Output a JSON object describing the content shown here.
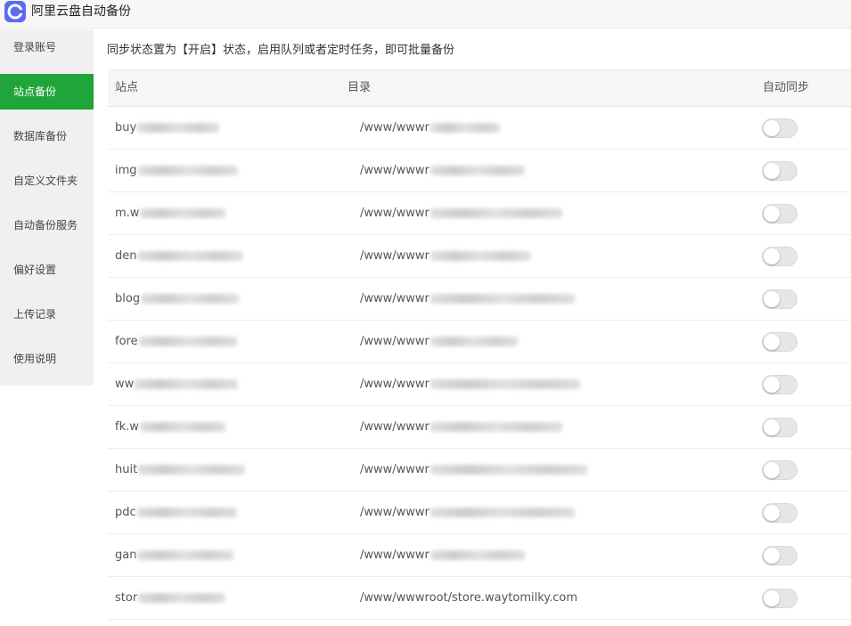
{
  "app": {
    "title": "阿里云盘自动备份",
    "logo_icon": "aliyun-drive-logo-icon",
    "accent_color": "#20a53a"
  },
  "sidebar": {
    "active_index": 1,
    "items": [
      {
        "label": "登录账号"
      },
      {
        "label": "站点备份"
      },
      {
        "label": "数据库备份"
      },
      {
        "label": "自定义文件夹"
      },
      {
        "label": "自动备份服务"
      },
      {
        "label": "偏好设置"
      },
      {
        "label": "上传记录"
      },
      {
        "label": "使用说明"
      }
    ]
  },
  "main": {
    "description": "同步状态置为【开启】状态，启用队列或者定时任务，即可批量备份",
    "table": {
      "headers": {
        "site": "站点",
        "directory": "目录",
        "auto_sync": "自动同步"
      },
      "rows": [
        {
          "site": "buy",
          "directory": "/www/wwwr",
          "auto_sync": false
        },
        {
          "site": "img",
          "directory": "/www/wwwr",
          "auto_sync": false
        },
        {
          "site": "m.w",
          "directory": "/www/wwwr",
          "auto_sync": false
        },
        {
          "site": "den",
          "directory": "/www/wwwr",
          "auto_sync": false
        },
        {
          "site": "blog",
          "directory": "/www/wwwr",
          "auto_sync": false
        },
        {
          "site": "fore",
          "directory": "/www/wwwr",
          "auto_sync": false
        },
        {
          "site": "ww",
          "directory": "/www/wwwr",
          "auto_sync": false
        },
        {
          "site": "fk.w",
          "directory": "/www/wwwr",
          "auto_sync": false
        },
        {
          "site": "huit",
          "directory": "/www/wwwr",
          "auto_sync": false
        },
        {
          "site": "pdc",
          "directory": "/www/wwwr",
          "auto_sync": false
        },
        {
          "site": "gan",
          "directory": "/www/wwwr",
          "auto_sync": false
        },
        {
          "site": "stor",
          "directory": "/www/wwwroot/store.waytomilky.com",
          "auto_sync": false
        }
      ]
    }
  }
}
